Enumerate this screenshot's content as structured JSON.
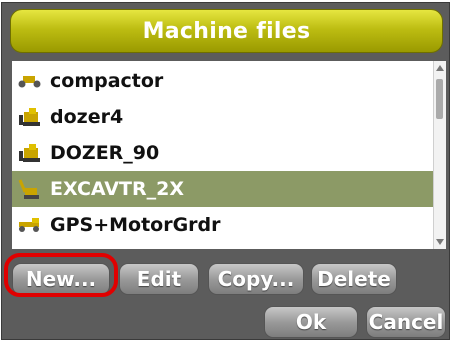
{
  "dialog": {
    "title": "Machine files"
  },
  "files": [
    {
      "name": "compactor",
      "icon": "compactor-icon"
    },
    {
      "name": "dozer4",
      "icon": "dozer-icon"
    },
    {
      "name": "DOZER_90",
      "icon": "dozer-icon"
    },
    {
      "name": "EXCAVTR_2X",
      "icon": "excavator-icon",
      "selected": true
    },
    {
      "name": "GPS+MotorGrdr",
      "icon": "motor-grader-icon"
    }
  ],
  "buttons": {
    "new": "New...",
    "edit": "Edit",
    "copy": "Copy...",
    "delete": "Delete",
    "ok": "Ok",
    "cancel": "Cancel"
  },
  "colors": {
    "title_bar": "#bdbd12",
    "selection": "#8c9a66",
    "highlight_ring": "#e00000"
  }
}
